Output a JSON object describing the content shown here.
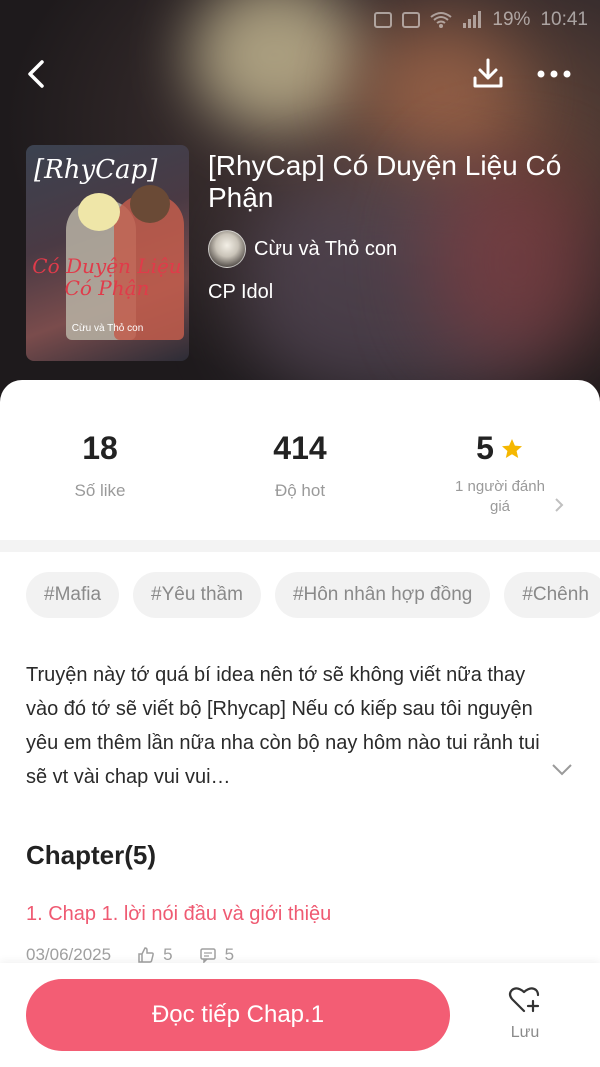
{
  "status_bar": {
    "battery": "19%",
    "time": "10:41"
  },
  "book": {
    "title": "[RhyCap] Có Duyện Liệu Có Phận",
    "author": "Cừu và Thỏ con",
    "category": "CP Idol",
    "cover": {
      "title_text": "[RhyCap]",
      "script_text": "Có Duyện Liệu Có Phận",
      "author_text": "Cừu và Thỏ con"
    }
  },
  "stats": {
    "likes": {
      "value": "18",
      "label": "Số like"
    },
    "hot": {
      "value": "414",
      "label": "Độ hot"
    },
    "rating": {
      "value": "5",
      "label": "1 người đánh giá"
    }
  },
  "tags": [
    "#Mafia",
    "#Yêu thầm",
    "#Hôn nhân hợp đồng",
    "#Chênh"
  ],
  "description": "Truyện này tớ quá bí idea nên tớ sẽ không viết nữa thay vào đó tớ sẽ viết bộ [Rhycap] Nếu có kiếp sau tôi nguyện yêu em thêm lần nữa nha còn bộ nay hôm nào tui rảnh tui sẽ vt vài chap vui vui…",
  "chapters": {
    "heading": "Chapter(5)",
    "items": [
      {
        "title": "1. Chap 1. lời nói đầu và giới thiệu",
        "date": "03/06/2025",
        "likes": "5",
        "comments": "5"
      }
    ]
  },
  "actions": {
    "read_button": "Đọc tiếp Chap.1",
    "save_label": "Lưu"
  },
  "colors": {
    "accent": "#f35d74",
    "chapter_link": "#ef5a72",
    "star": "#f5b700"
  }
}
